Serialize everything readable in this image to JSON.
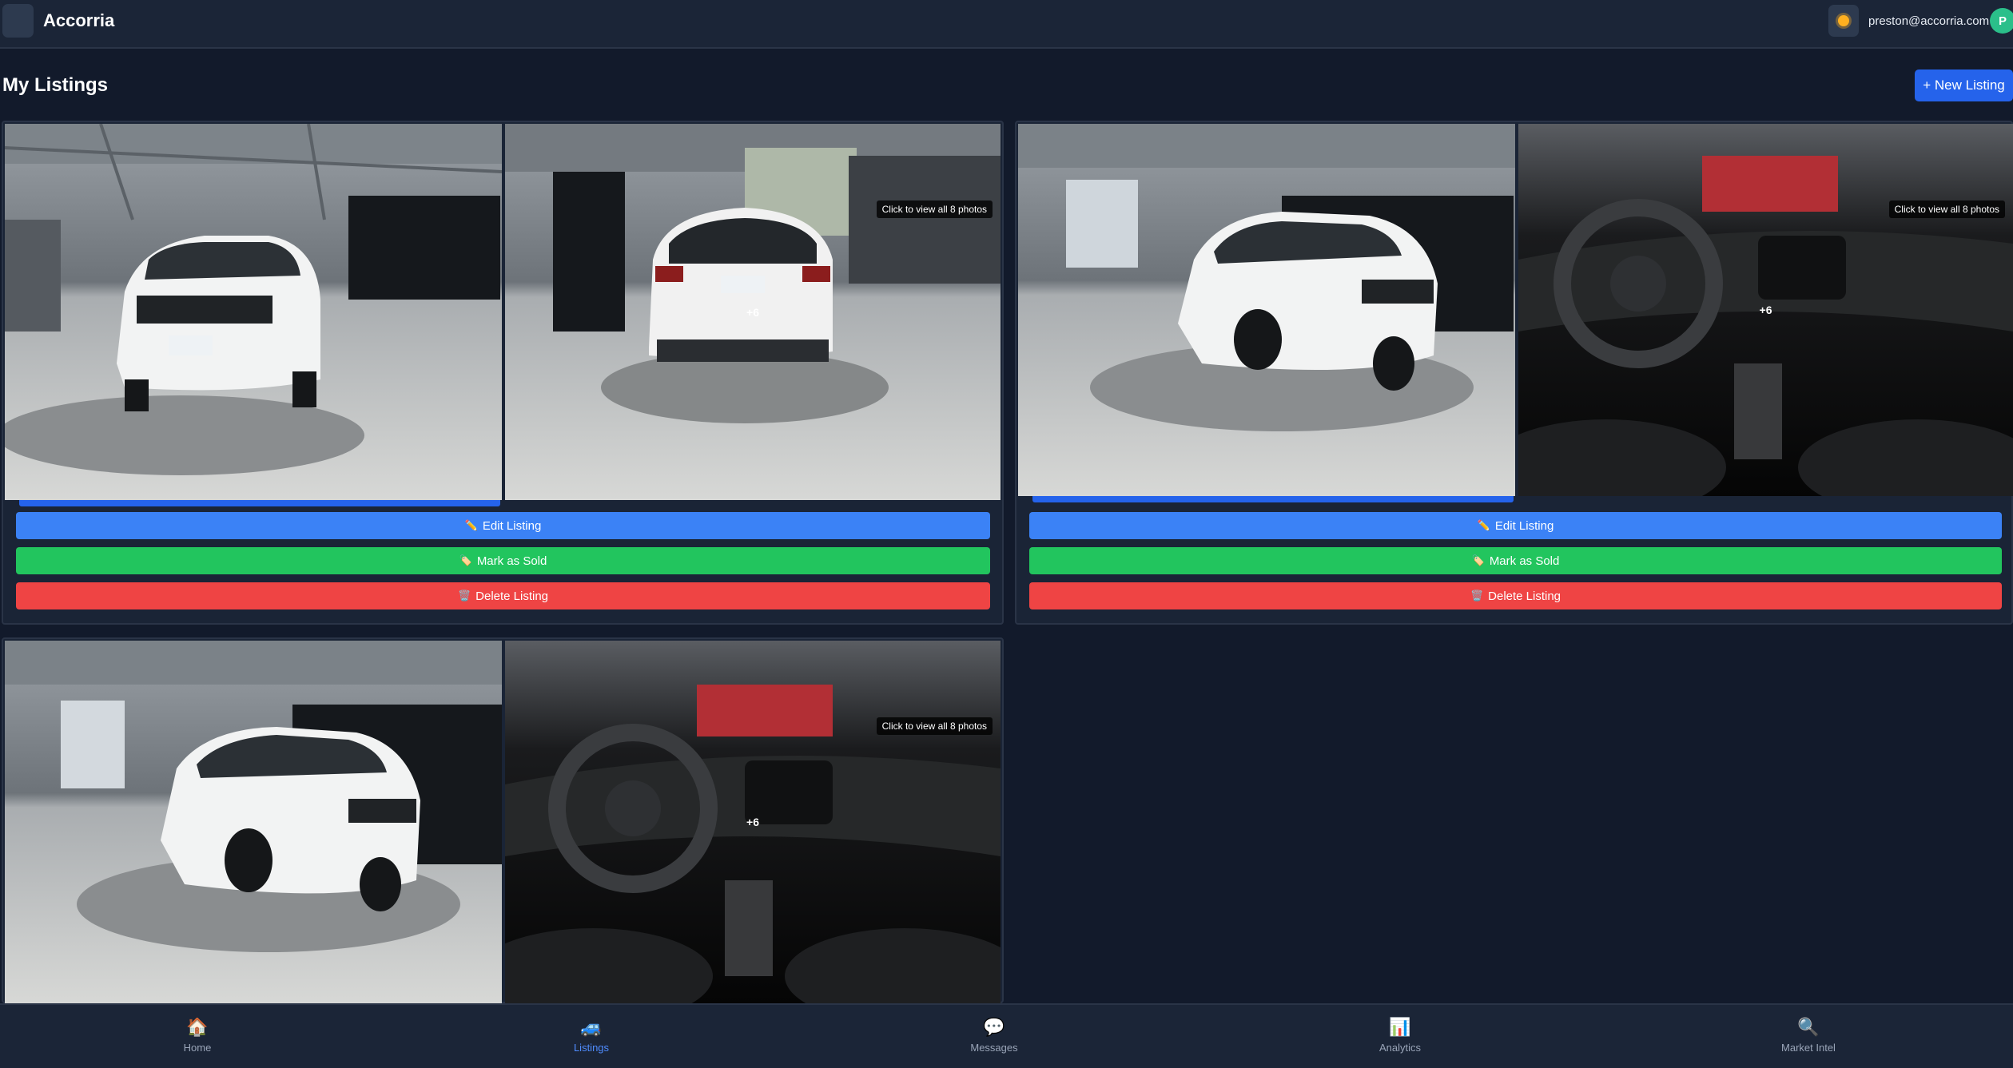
{
  "header": {
    "brand": "Accorria",
    "user_email": "preston@accorria.com",
    "avatar_initial": "P",
    "icons": [
      "menu-icon",
      "sun-icon"
    ]
  },
  "page": {
    "title": "My Listings",
    "new_listing_label": "+ New Listing"
  },
  "listings": [
    {
      "photo_overlay": "Click to view all 8 photos",
      "extra_count": "+6",
      "actions": {
        "edit": "Edit Listing",
        "sold": "Mark as Sold",
        "delete": "Delete Listing"
      }
    },
    {
      "photo_overlay": "Click to view all 8 photos",
      "extra_count": "+6",
      "actions": {
        "edit": "Edit Listing",
        "sold": "Mark as Sold",
        "delete": "Delete Listing"
      }
    },
    {
      "photo_overlay": "Click to view all 8 photos",
      "extra_count": "+6"
    }
  ],
  "action_icons": {
    "edit": "✏️",
    "sold": "🏷️",
    "delete": "🗑️"
  },
  "bottom_nav": {
    "active": "Listings",
    "items": [
      {
        "label": "Home",
        "icon": "🏠"
      },
      {
        "label": "Listings",
        "icon": "🚙"
      },
      {
        "label": "Messages",
        "icon": "💬"
      },
      {
        "label": "Analytics",
        "icon": "📊"
      },
      {
        "label": "Market Intel",
        "icon": "🔍"
      }
    ]
  },
  "colors": {
    "background": "#121a2b",
    "header": "#1b2537",
    "primary": "#2563eb",
    "edit": "#3b82f6",
    "sold": "#22c55e",
    "delete": "#ef4444"
  }
}
